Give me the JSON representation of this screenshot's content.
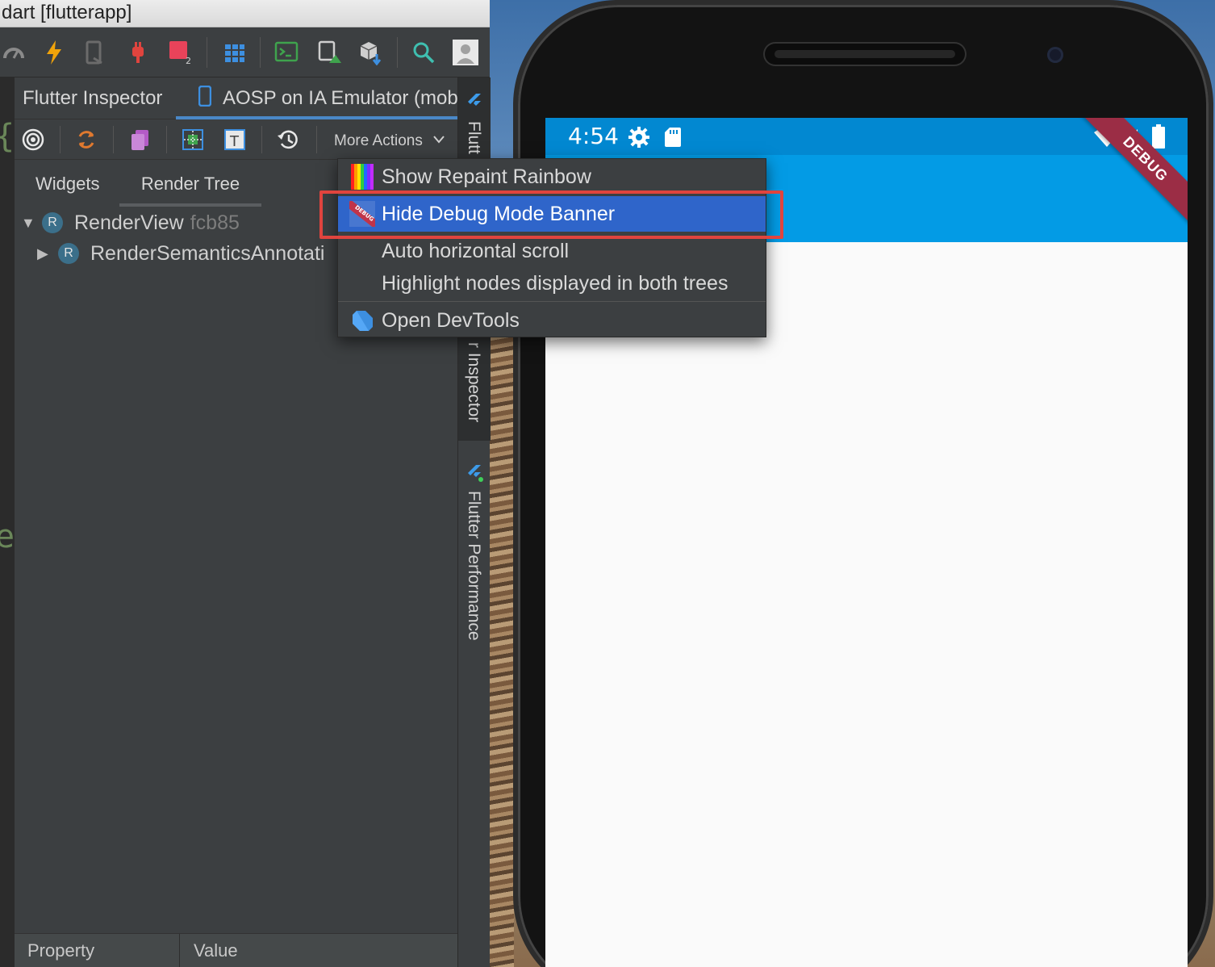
{
  "window": {
    "title": "dart [flutterapp]"
  },
  "panel": {
    "tabs": [
      {
        "label": "Flutter Inspector"
      },
      {
        "label": "AOSP on IA Emulator (mob"
      }
    ],
    "more_actions_label": "More Actions",
    "subtabs": [
      {
        "label": "Widgets"
      },
      {
        "label": "Render Tree"
      }
    ],
    "tree": [
      {
        "badge": "R",
        "name": "RenderView",
        "id": "fcb85"
      },
      {
        "badge": "R",
        "name": "RenderSemanticsAnnotati"
      }
    ],
    "properties": {
      "col_property": "Property",
      "col_value": "Value"
    }
  },
  "side_strip": {
    "inspector_label_top": "Flutt",
    "inspector_label_bottom": "r Inspector",
    "performance_label": "Flutter Performance"
  },
  "more_actions_menu": {
    "items": [
      {
        "label": "Show Repaint Rainbow",
        "icon": "rainbow-icon"
      },
      {
        "label": "Hide Debug Mode Banner",
        "icon": "debug-banner-icon",
        "selected": true
      },
      {
        "label": "Auto horizontal scroll"
      },
      {
        "label": "Highlight nodes displayed in both trees"
      },
      {
        "label": "Open DevTools",
        "icon": "dart-icon"
      }
    ]
  },
  "device": {
    "clock": "4:54",
    "debug_banner": "DEBUG",
    "status_icons": [
      "gear-icon",
      "sd-card-icon",
      "wifi-icon",
      "signal-icon",
      "battery-icon"
    ]
  },
  "colors": {
    "ide_bg": "#3c3f41",
    "accent_tab": "#4a88c7",
    "menu_selected": "#2f65ca",
    "highlight_box": "#e0443e",
    "status_bar": "#0288d1",
    "app_bar": "#039be5",
    "debug_ribbon": "#9b2d45"
  }
}
